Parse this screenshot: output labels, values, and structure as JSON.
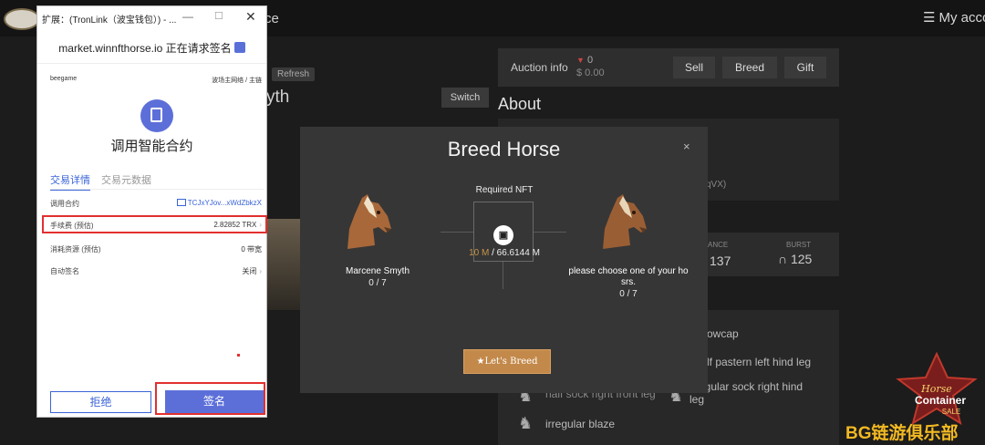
{
  "background_page": {
    "site_title_fragment": "ce",
    "account_label": "My acco",
    "refresh_label": "Refresh",
    "horse_name_fragment": "yth",
    "switch_label": "Switch",
    "auction": {
      "label": "Auction info",
      "count": "0",
      "price": "$ 0.00",
      "sell_label": "Sell",
      "breed_label": "Breed",
      "gift_label": "Gift"
    },
    "about_title": "About",
    "about_code_fragment": "qVX)",
    "stats": {
      "balance_label": "ANCE",
      "balance_value": "137",
      "burst_label": "BURST",
      "burst_value": "125"
    },
    "traits": {
      "t1": "owcap",
      "t2": "lf pastern left hind leg",
      "t3_a": "half sock right front leg",
      "t3_b": "egular sock right hind",
      "t3_c": "leg",
      "t4": "irregular blaze"
    },
    "badge": {
      "line1": "Horse",
      "line2": "Container",
      "line3": "SALE"
    },
    "watermark": "BG链游俱乐部"
  },
  "tronlink": {
    "window_title": "扩展：(TronLink（波宝钱包）) - ...",
    "site_request": "market.winnfthorse.io 正在请求签名",
    "account_name": "beegame",
    "network": "波场主网络 / 主链",
    "heading": "调用智能合约",
    "tabs": {
      "detail": "交易详情",
      "raw": "交易元数据"
    },
    "rows": {
      "contract_label": "调用合约",
      "contract_value": "TCJxYJov...xWdZbkzX",
      "fee_label": "手续费 (预估)",
      "fee_value": "2.82852 TRX",
      "resource_label": "消耗资源 (预估)",
      "resource_value": "0 带宽",
      "autosign_label": "自动签名",
      "autosign_value": "关闭"
    },
    "reject_label": "拒绝",
    "sign_label": "签名"
  },
  "modal": {
    "title": "Breed Horse",
    "close_glyph": "×",
    "left_horse_name": "Marcene Smyth",
    "left_horse_count": "0 / 7",
    "right_horse_name": "please choose one of your ho srs.",
    "right_horse_count": "0 / 7",
    "required_label": "Required NFT",
    "nft_owned": "10 M",
    "nft_separator": " /  ",
    "nft_required": "66.6144 M",
    "breed_button": "★Let's Breed"
  },
  "colors": {
    "accent_gold": "#c3894a",
    "tronlink_blue": "#5c6fd9",
    "highlight_red": "#e23030",
    "watermark_yellow": "#f2b922"
  }
}
